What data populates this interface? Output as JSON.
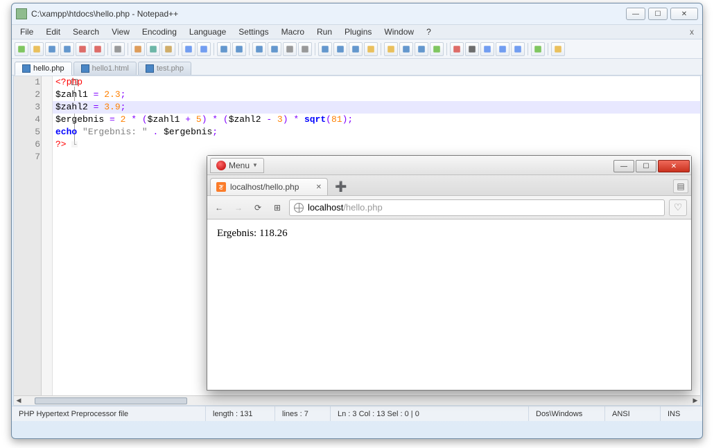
{
  "notepadpp": {
    "title": "C:\\xampp\\htdocs\\hello.php - Notepad++",
    "menus": [
      "File",
      "Edit",
      "Search",
      "View",
      "Encoding",
      "Language",
      "Settings",
      "Macro",
      "Run",
      "Plugins",
      "Window",
      "?"
    ],
    "toolbar_icons": [
      "new-file",
      "open-file",
      "save",
      "save-all",
      "close",
      "close-all",
      "print",
      "cut",
      "copy",
      "paste",
      "undo",
      "redo",
      "find",
      "replace",
      "zoom-in",
      "zoom-out",
      "sync-v",
      "sync-h",
      "word-wrap",
      "show-all",
      "indent-guide",
      "user-lang",
      "folder",
      "doc-map",
      "func-list",
      "monitor",
      "record",
      "stop",
      "play",
      "fast-fwd",
      "play-multi",
      "spellcheck",
      "open-folder"
    ],
    "tabs": [
      {
        "label": "hello.php",
        "active": true
      },
      {
        "label": "hello1.html",
        "active": false
      },
      {
        "label": "test.php",
        "active": false
      }
    ],
    "code": {
      "line_numbers": [
        "1",
        "2",
        "3",
        "4",
        "5",
        "6",
        "7"
      ],
      "current_line_index": 2,
      "lines": [
        {
          "tokens": [
            {
              "t": "<?php",
              "c": "c-tag"
            }
          ]
        },
        {
          "tokens": [
            {
              "t": "$zahl1",
              "c": "c-var"
            },
            {
              "t": " = ",
              "c": "c-op"
            },
            {
              "t": "2.3",
              "c": "c-num"
            },
            {
              "t": ";",
              "c": "c-op"
            }
          ]
        },
        {
          "tokens": [
            {
              "t": "$zahl2",
              "c": "c-var"
            },
            {
              "t": " = ",
              "c": "c-op"
            },
            {
              "t": "3.9",
              "c": "c-num"
            },
            {
              "t": ";",
              "c": "c-op"
            }
          ]
        },
        {
          "tokens": [
            {
              "t": "$ergebnis",
              "c": "c-var"
            },
            {
              "t": " = ",
              "c": "c-op"
            },
            {
              "t": "2",
              "c": "c-num"
            },
            {
              "t": " * (",
              "c": "c-op"
            },
            {
              "t": "$zahl1",
              "c": "c-var"
            },
            {
              "t": " + ",
              "c": "c-op"
            },
            {
              "t": "5",
              "c": "c-num"
            },
            {
              "t": ") * (",
              "c": "c-op"
            },
            {
              "t": "$zahl2",
              "c": "c-var"
            },
            {
              "t": " - ",
              "c": "c-op"
            },
            {
              "t": "3",
              "c": "c-num"
            },
            {
              "t": ") * ",
              "c": "c-op"
            },
            {
              "t": "sqrt",
              "c": "c-kw"
            },
            {
              "t": "(",
              "c": "c-op"
            },
            {
              "t": "81",
              "c": "c-num"
            },
            {
              "t": ");",
              "c": "c-op"
            }
          ]
        },
        {
          "tokens": [
            {
              "t": "echo",
              "c": "c-kw"
            },
            {
              "t": " ",
              "c": ""
            },
            {
              "t": "\"Ergebnis: \"",
              "c": "c-str"
            },
            {
              "t": " . ",
              "c": "c-op"
            },
            {
              "t": "$ergebnis",
              "c": "c-var"
            },
            {
              "t": ";",
              "c": "c-op"
            }
          ]
        },
        {
          "tokens": [
            {
              "t": "?>",
              "c": "c-tag"
            }
          ]
        },
        {
          "tokens": [
            {
              "t": "",
              "c": ""
            }
          ]
        }
      ]
    },
    "status": {
      "filetype": "PHP Hypertext Preprocessor file",
      "length": "length : 131",
      "lines": "lines : 7",
      "pos": "Ln : 3    Col : 13    Sel : 0 | 0",
      "eol": "Dos\\Windows",
      "encoding": "ANSI",
      "mode": "INS"
    }
  },
  "browser": {
    "menu_label": "Menu",
    "tab_title": "localhost/hello.php",
    "url_host": "localhost",
    "url_path": "/hello.php",
    "page_output": "Ergebnis: 118.26"
  }
}
